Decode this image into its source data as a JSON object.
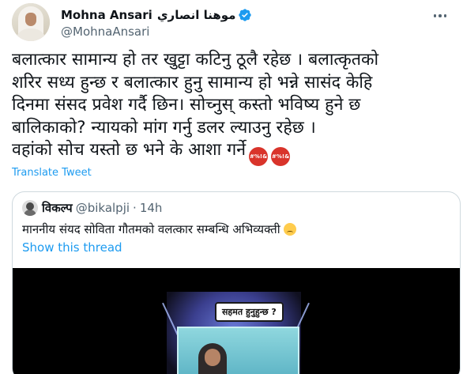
{
  "author": {
    "display_name": "Mohna Ansari",
    "arabic_name": "موهنا انصاري",
    "handle": "@MohnaAnsari",
    "verified": true
  },
  "tweet": {
    "lines": [
      "बलात्कार सामान्य हो तर खुट्टा कटिनु ठूलै रहेछ । बलात्कृतको",
      "शरिर सध्य हुन्छ र बलात्कार हुनु सामान्य हो भन्ने सासंद केहि",
      "दिनमा संसद प्रवेश गर्दै छिन। सोच्नुस् कस्तो भविष्य हुने छ",
      "बालिकाको? न्यायको मांग गर्नु डलर ल्याउनु रहेछ ।",
      "वहांको सोच यस्तो छ भने के आशा गर्ने"
    ],
    "emoji_label": "#%!&",
    "translate_label": "Translate Tweet"
  },
  "quote": {
    "name": "विकल्प",
    "handle": "@bikalpji",
    "separator": "·",
    "time": "14h",
    "text": "माननीय संयद सोविता गौतमको वलत्कार सम्बन्धि अभिव्यक्ती",
    "show_thread": "Show this thread",
    "media_caption": "सहमत हुनुहुन्छ ?"
  },
  "colors": {
    "link": "#1d9bf0",
    "verified": "#1d9bf0",
    "secondary_text": "#536471",
    "border": "#cfd9de"
  },
  "icons": {
    "verified": "verified-badge-icon",
    "more": "more-options-icon",
    "angry_emoji": "angry-face-emoji"
  }
}
